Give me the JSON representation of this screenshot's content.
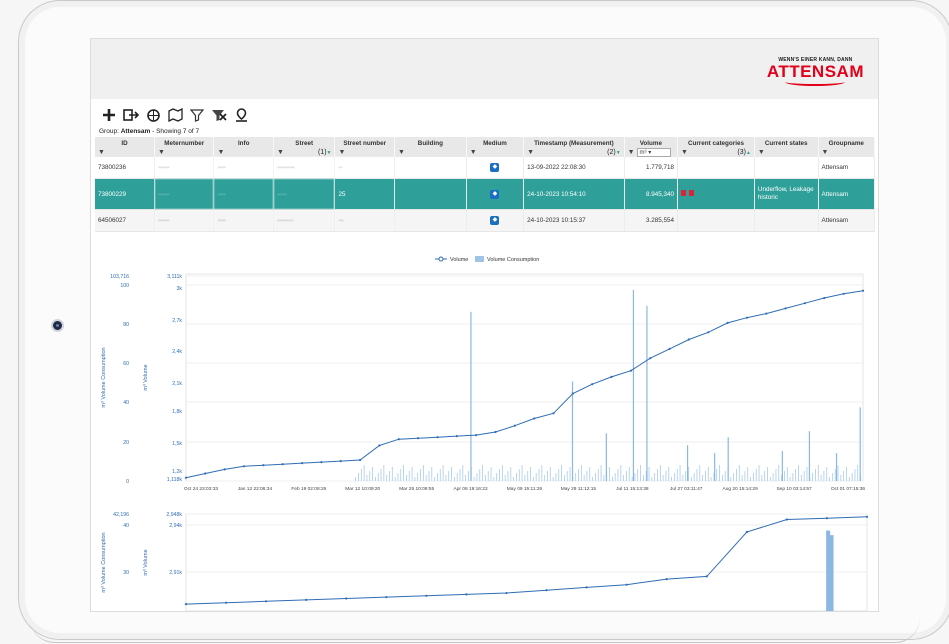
{
  "brand": {
    "tagline": "WENN'S EINER KANN, DANN",
    "name": "ATTENSAM"
  },
  "toolbar": {
    "icons": [
      "add-icon",
      "export-icon",
      "refresh-icon",
      "map-icon",
      "filter-icon",
      "clear-filter-icon",
      "location-icon"
    ]
  },
  "group": {
    "prefix": "Group: ",
    "name": "Attensam",
    "suffix": " - Showing 7 of 7"
  },
  "table": {
    "columns": [
      "ID",
      "Meternumber",
      "Info",
      "Street",
      "Street number",
      "Building",
      "Medium",
      "Timestamp (Measurement)",
      "Volume",
      "Current categories",
      "Current states",
      "Groupname"
    ],
    "sort_marks": {
      "street": "(1)",
      "timestamp": "(2)",
      "categories": "(3)"
    },
    "unit_select": "m³",
    "rows": [
      {
        "id": "73800236",
        "meter": "·······",
        "info": "·····",
        "street": "···········",
        "number": "··",
        "timestamp": "13-09-2022 22:08:30",
        "volume": "1.779,718",
        "states": "",
        "groupname": "Attensam"
      },
      {
        "id": "73800229",
        "meter": "·······",
        "info": "·····",
        "street": "······",
        "number": "25",
        "timestamp": "24-10-2023 10:54:10",
        "volume": "8.945,340",
        "states": "Underflow, Leakage historic",
        "groupname": "Attensam"
      },
      {
        "id": "64506027",
        "meter": "·······",
        "info": "·····",
        "street": "··········",
        "number": "···",
        "timestamp": "24-10-2023 10:15:37",
        "volume": "3.285,554",
        "states": "",
        "groupname": "Attensam"
      }
    ]
  },
  "chart_data": [
    {
      "type": "line",
      "legend": [
        "Volume",
        "Volume Consumption"
      ],
      "ylabel_left": "m³ Volume Consumption",
      "ylabel_right": "m³ Volume",
      "y_left_ticks": [
        "103,716",
        "100",
        "80",
        "60",
        "40",
        "20",
        "0"
      ],
      "y_right_ticks": [
        "3,111k",
        "3k",
        "2,7k",
        "2,4k",
        "2,1k",
        "1,8k",
        "1,5k",
        "1,2k",
        "1,118k"
      ],
      "x_ticks": [
        "Oct 24 23:03:33",
        "Jan 12 22:06:34",
        "Feb 19 02:08:26",
        "Mar 12 10:09:20",
        "Mar 25 10:09:55",
        "Apr 08 19:16:22",
        "May 09 15:11:26",
        "May 29 11:12:15",
        "Jul 11 15:13:38",
        "Jul 27 03:11:47",
        "Aug 20 15:14:29",
        "Sep 10 03:14:57",
        "Oct 01 07:15:36"
      ],
      "volume_series_k": [
        1.15,
        1.19,
        1.23,
        1.26,
        1.27,
        1.28,
        1.29,
        1.3,
        1.31,
        1.32,
        1.46,
        1.52,
        1.53,
        1.54,
        1.55,
        1.56,
        1.59,
        1.65,
        1.72,
        1.77,
        1.96,
        2.05,
        2.12,
        2.18,
        2.3,
        2.39,
        2.48,
        2.55,
        2.64,
        2.69,
        2.73,
        2.78,
        2.83,
        2.88,
        2.92,
        2.95
      ],
      "consumption_spikes": [
        {
          "x": 0.42,
          "v": 85
        },
        {
          "x": 0.57,
          "v": 50
        },
        {
          "x": 0.62,
          "v": 24
        },
        {
          "x": 0.66,
          "v": 96
        },
        {
          "x": 0.68,
          "v": 88
        },
        {
          "x": 0.74,
          "v": 18
        },
        {
          "x": 0.78,
          "v": 14
        },
        {
          "x": 0.8,
          "v": 22
        },
        {
          "x": 0.88,
          "v": 15
        },
        {
          "x": 0.92,
          "v": 25
        },
        {
          "x": 0.96,
          "v": 14
        },
        {
          "x": 0.995,
          "v": 37
        }
      ]
    },
    {
      "type": "line",
      "ylabel_left": "m³ Volume Consumption",
      "ylabel_right": "m³ Volume",
      "y_left_ticks": [
        "42,196",
        "40",
        "30"
      ],
      "y_right_ticks": [
        "2,948k",
        "2,94k",
        "2,91k"
      ],
      "volume_series_k": [
        2.885,
        2.886,
        2.887,
        2.888,
        2.889,
        2.89,
        2.891,
        2.892,
        2.893,
        2.895,
        2.897,
        2.899,
        2.903,
        2.905,
        2.937,
        2.946,
        2.947,
        2.948
      ],
      "consumption_spikes": [
        {
          "x": 0.94,
          "v": 35
        },
        {
          "x": 0.945,
          "v": 33
        }
      ]
    }
  ]
}
